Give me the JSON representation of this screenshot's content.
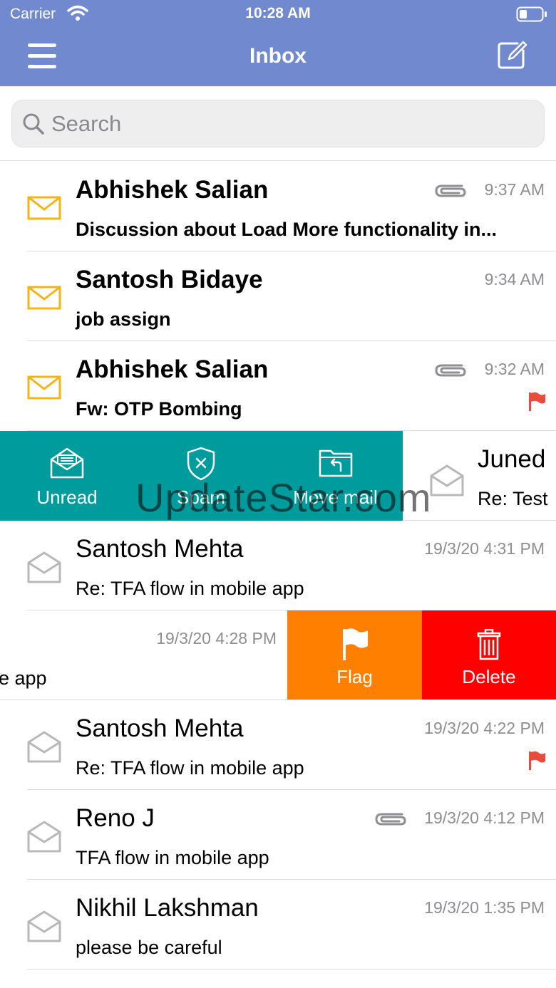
{
  "status": {
    "carrier": "Carrier",
    "time": "10:28 AM"
  },
  "nav": {
    "title": "Inbox"
  },
  "search": {
    "placeholder": "Search"
  },
  "colors": {
    "nav": "#7189CF",
    "teal": "#009B9C",
    "orange": "#FF8000",
    "red": "#FF0000",
    "unread_envelope": "#F2B417",
    "read_envelope": "#B8B8B8",
    "flag": "#E84C3D"
  },
  "emails": [
    {
      "sender": "Abhishek Salian",
      "subject": "Discussion about Load More functionality in...",
      "time": "9:37 AM",
      "unread": true,
      "attachment": true,
      "flagged": false
    },
    {
      "sender": "Santosh Bidaye",
      "subject": "job assign",
      "time": "9:34 AM",
      "unread": true,
      "attachment": false,
      "flagged": false
    },
    {
      "sender": "Abhishek Salian",
      "subject": "Fw: OTP Bombing",
      "time": "9:32 AM",
      "unread": true,
      "attachment": true,
      "flagged": true
    },
    {
      "sender": "Juned",
      "subject": "Re: Test",
      "time": "",
      "unread": false,
      "attachment": false,
      "flagged": false
    },
    {
      "sender": "Santosh Mehta",
      "subject": "Re: TFA flow in mobile app",
      "time": "19/3/20 4:31 PM",
      "unread": false,
      "attachment": false,
      "flagged": false
    },
    {
      "sender": "",
      "subject": "e app",
      "time": "19/3/20 4:28 PM",
      "unread": false,
      "attachment": false,
      "flagged": false
    },
    {
      "sender": "Santosh Mehta",
      "subject": "Re: TFA flow in mobile app",
      "time": "19/3/20 4:22 PM",
      "unread": false,
      "attachment": false,
      "flagged": true
    },
    {
      "sender": "Reno J",
      "subject": "TFA flow in mobile app",
      "time": "19/3/20 4:12 PM",
      "unread": false,
      "attachment": true,
      "flagged": false
    },
    {
      "sender": "Nikhil Lakshman",
      "subject": "please be careful",
      "time": "19/3/20 1:35 PM",
      "unread": false,
      "attachment": false,
      "flagged": false
    }
  ],
  "swipe_left_actions": {
    "unread": "Unread",
    "spam": "Spam",
    "move": "Move mail"
  },
  "swipe_right_actions": {
    "flag": "Flag",
    "delete": "Delete"
  },
  "watermark": "UpdateStar.com"
}
